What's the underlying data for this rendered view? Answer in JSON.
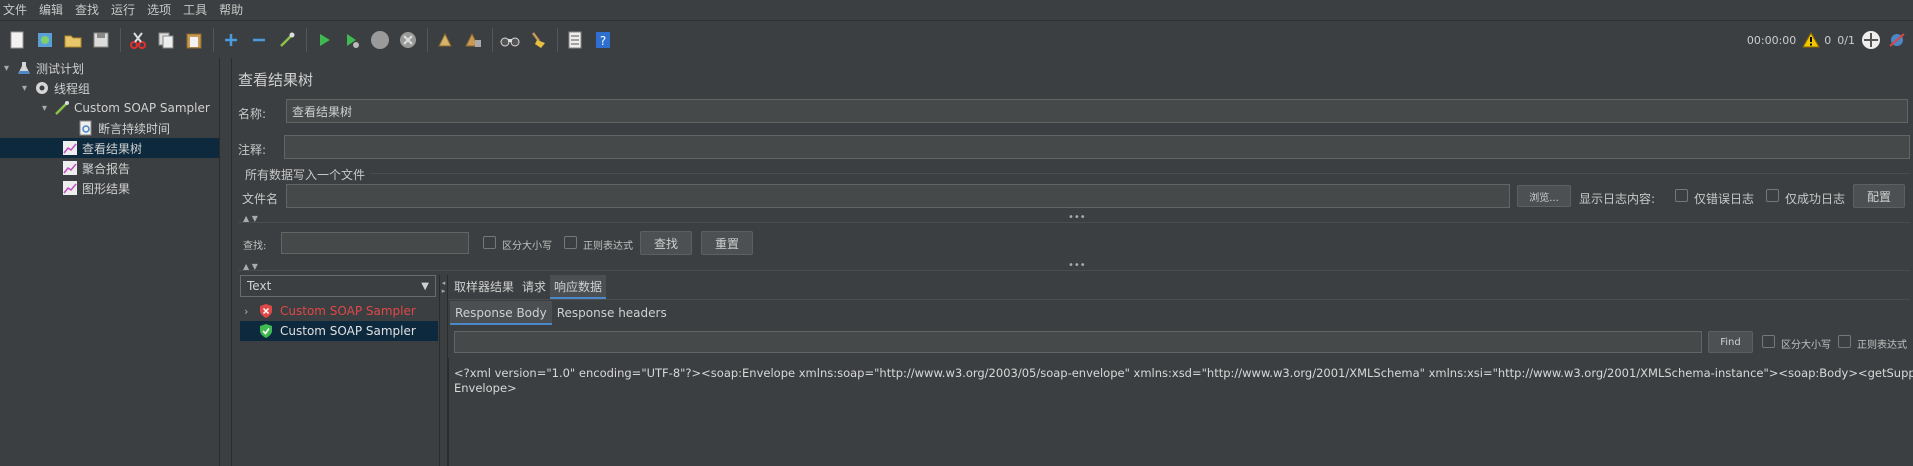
{
  "menu": [
    "文件",
    "编辑",
    "查找",
    "运行",
    "选项",
    "工具",
    "帮助"
  ],
  "toolbar": {
    "elapsed": "00:00:00",
    "warnings": "0",
    "threads": "0/1"
  },
  "tree": {
    "test_plan": "测试计划",
    "thread_group": "线程组",
    "sampler": "Custom SOAP Sampler",
    "assertion": "断言持续时间",
    "view_results_tree": "查看结果树",
    "aggregate_report": "聚合报告",
    "graph_results": "图形结果"
  },
  "panel": {
    "title": "查看结果树",
    "name_label": "名称:",
    "name_value": "查看结果树",
    "comment_label": "注释:",
    "comment_value": "",
    "write_all_label": "所有数据写入一个文件",
    "filename_label": "文件名",
    "filename_value": "",
    "browse_label": "浏览...",
    "log_display_label": "显示日志内容:",
    "errors_only_label": "仅错误日志",
    "success_only_label": "仅成功日志",
    "config_label": "配置",
    "search_label": "查找:",
    "search_value": "",
    "case_sensitive_label": "区分大小写",
    "regex_label": "正则表达式",
    "find_button": "查找",
    "reset_button": "重置"
  },
  "results": {
    "renderer": "Text",
    "items": [
      {
        "label": "Custom SOAP Sampler",
        "status": "error"
      },
      {
        "label": "Custom SOAP Sampler",
        "status": "success"
      }
    ]
  },
  "tabs": [
    "取样器结果",
    "请求",
    "响应数据"
  ],
  "subtabs": [
    "Response Body",
    "Response headers"
  ],
  "body_search": {
    "find_label": "Find",
    "case_label": "区分大小写",
    "regex_label": "正则表达式"
  },
  "response": {
    "line1": "<?xml version=\"1.0\" encoding=\"UTF-8\"?><soap:Envelope xmlns:soap=\"http://www.w3.org/2003/05/soap-envelope\" xmlns:xsd=\"http://www.w3.org/2001/XMLSchema\" xmlns:xsi=\"http://www.w3.org/2001/XMLSchema-instance\"><soap:Body><getSupportCityStringResponse",
    "line2": "Envelope>"
  },
  "colors": {
    "error_red": "#e04848",
    "success_green": "#3fb950",
    "selection": "#0d293e",
    "accent": "#4a88c7"
  }
}
